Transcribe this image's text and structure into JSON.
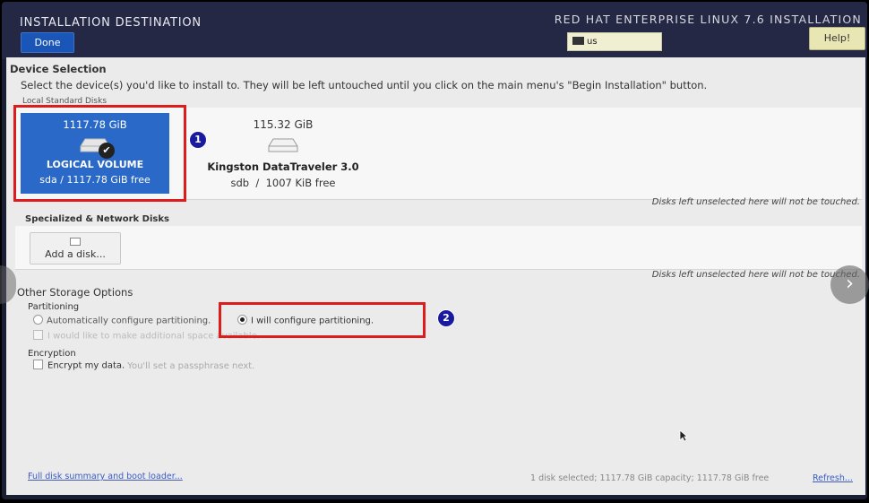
{
  "header": {
    "title": "INSTALLATION DESTINATION",
    "done_label": "Done",
    "product": "RED HAT ENTERPRISE LINUX 7.6 INSTALLATION",
    "keyboard_layout": "us",
    "help_label": "Help!"
  },
  "device_selection": {
    "title": "Device Selection",
    "instruction": "Select the device(s) you'd like to install to.  They will be left untouched until you click on the main menu's \"Begin Installation\" button.",
    "local_label": "Local Standard Disks",
    "disks": [
      {
        "size": "1117.78 GiB",
        "name": "LOGICAL VOLUME",
        "device": "sda",
        "sep": "/",
        "free": "1117.78 GiB free",
        "selected": true
      },
      {
        "size": "115.32 GiB",
        "name": "Kingston DataTraveler 3.0",
        "device": "sdb",
        "sep": "/",
        "free": "1007 KiB free",
        "selected": false
      }
    ],
    "untouched_note": "Disks left unselected here will not be touched."
  },
  "specialized": {
    "label": "Specialized & Network Disks",
    "add_disk_label": "Add a disk...",
    "untouched_note": "Disks left unselected here will not be touched."
  },
  "other_storage": {
    "title": "Other Storage Options",
    "partitioning_label": "Partitioning",
    "auto_label": "Automatically configure partitioning.",
    "manual_label": "I will configure partitioning.",
    "selected": "manual",
    "additional_label": "I would like to make additional space available.",
    "encryption_label": "Encryption",
    "encrypt_label": "Encrypt my data.",
    "encrypt_hint": "You'll set a passphrase next."
  },
  "footer": {
    "summary_link": "Full disk summary and boot loader...",
    "status": "1 disk selected; 1117.78 GiB capacity; 1117.78 GiB free",
    "refresh_link": "Refresh..."
  },
  "annotations": {
    "badge_1": "1",
    "badge_2": "2"
  },
  "colors": {
    "highlight": "#dd1c1c",
    "selected_disk": "#2a69c8",
    "done_button": "#1a56b8"
  }
}
